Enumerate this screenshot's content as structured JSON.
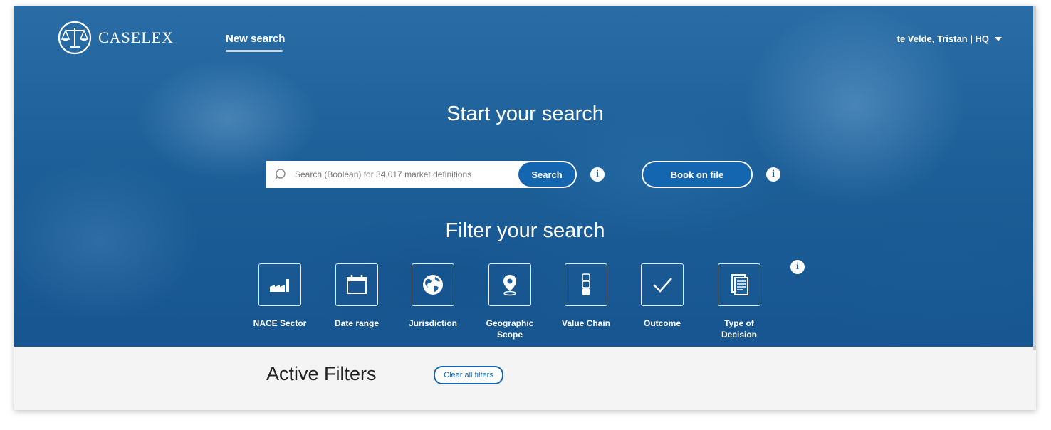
{
  "brand": {
    "name": "CASELEX"
  },
  "nav": {
    "new_search": "New search"
  },
  "user": {
    "label": "te Velde, Tristan | HQ"
  },
  "hero": {
    "search_title": "Start your search",
    "search_placeholder": "Search (Boolean) for 34,017 market definitions",
    "search_button": "Search",
    "book_button": "Book on file",
    "filter_title": "Filter your search"
  },
  "filters": [
    {
      "label": "NACE Sector",
      "icon": "factory-icon"
    },
    {
      "label": "Date range",
      "icon": "calendar-icon"
    },
    {
      "label": "Jurisdiction",
      "icon": "globe-icon"
    },
    {
      "label": "Geographic Scope",
      "icon": "map-pin-icon"
    },
    {
      "label": "Value Chain",
      "icon": "chain-icon"
    },
    {
      "label": "Outcome",
      "icon": "checkmark-icon"
    },
    {
      "label": "Type of Decision",
      "icon": "document-icon"
    }
  ],
  "active_filters": {
    "title": "Active Filters",
    "clear_button": "Clear all filters"
  },
  "colors": {
    "primary": "#1466b0",
    "hero": "#1d5f98",
    "panel": "#f4f4f4"
  }
}
